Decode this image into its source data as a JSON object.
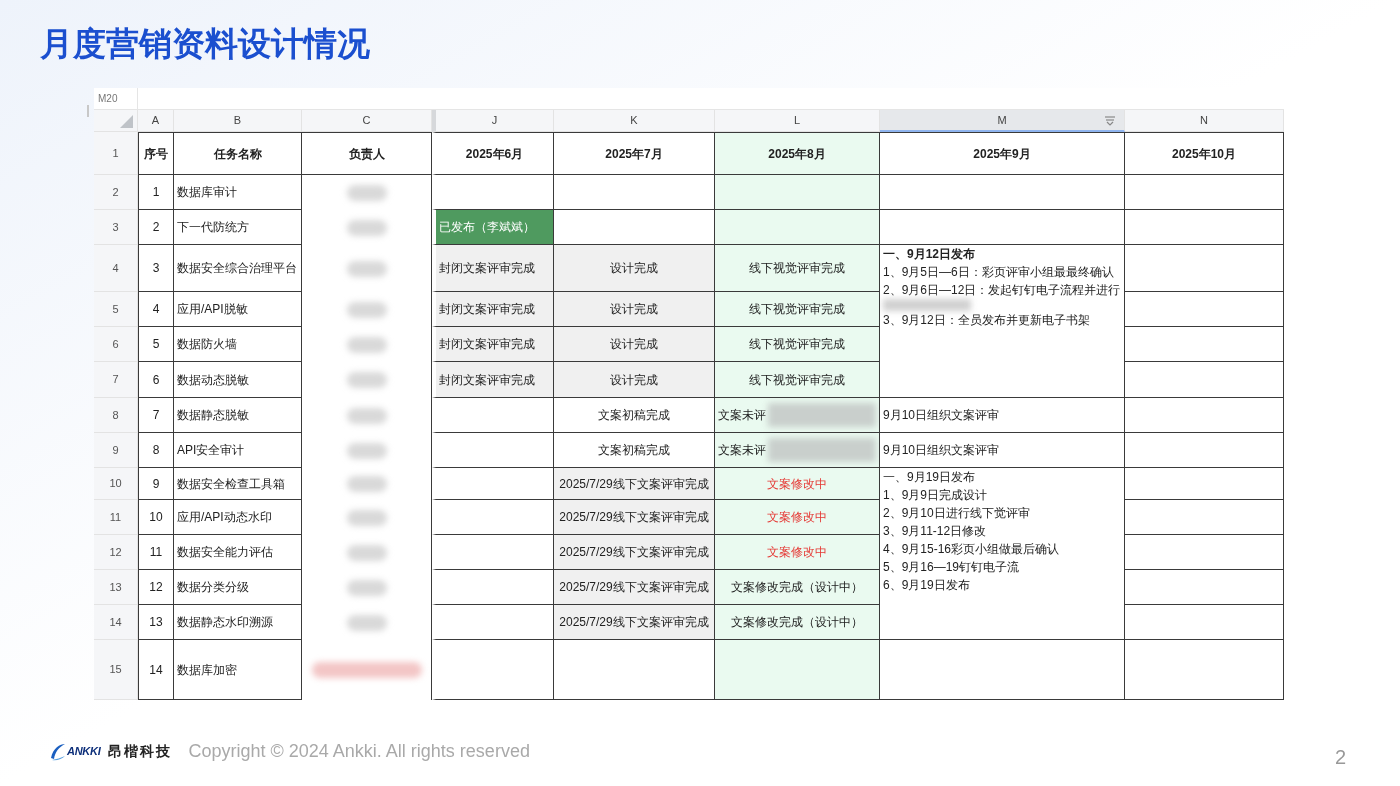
{
  "title": "月度营销资料设计情况",
  "sheet": {
    "name_box": "M20",
    "columns": [
      {
        "letter": "A",
        "highlight": false,
        "selected": false
      },
      {
        "letter": "B",
        "highlight": false,
        "selected": false
      },
      {
        "letter": "C",
        "highlight": false,
        "selected": false
      },
      {
        "letter": "J",
        "highlight": false,
        "selected": false
      },
      {
        "letter": "K",
        "highlight": false,
        "selected": false
      },
      {
        "letter": "L",
        "highlight": true,
        "selected": false
      },
      {
        "letter": "M",
        "highlight": false,
        "selected": true
      },
      {
        "letter": "N",
        "highlight": false,
        "selected": false
      }
    ],
    "rows": [
      {
        "number": "1",
        "cells": {
          "A": {
            "kind": "heading",
            "text": "序号"
          },
          "B": {
            "kind": "heading",
            "text": "任务名称"
          },
          "C": {
            "kind": "heading",
            "text": "负责人"
          },
          "J": {
            "kind": "heading",
            "text": "2025年6月"
          },
          "K": {
            "kind": "heading",
            "text": "2025年7月"
          },
          "L": {
            "kind": "heading",
            "text": "2025年8月"
          },
          "M": {
            "kind": "heading",
            "text": "2025年9月"
          },
          "N": {
            "kind": "heading",
            "text": "2025年10月"
          }
        }
      },
      {
        "number": "2",
        "cells": {
          "A": {
            "kind": "text",
            "text": "1"
          },
          "B": {
            "kind": "text",
            "text": "数据库审计"
          },
          "C": {
            "kind": "redacted"
          },
          "J": {
            "kind": "plain"
          },
          "K": {
            "kind": "plain"
          },
          "L": {
            "kind": "plain"
          },
          "M": {
            "kind": "plain"
          },
          "N": {
            "kind": "plain"
          }
        }
      },
      {
        "number": "3",
        "cells": {
          "A": {
            "kind": "text",
            "text": "2"
          },
          "B": {
            "kind": "text",
            "text": "下一代防统方"
          },
          "C": {
            "kind": "redacted"
          },
          "J": {
            "kind": "published",
            "text": "已发布（李斌斌）"
          },
          "K": {
            "kind": "plain"
          },
          "L": {
            "kind": "plain"
          },
          "M": {
            "kind": "plain"
          },
          "N": {
            "kind": "plain"
          }
        }
      },
      {
        "number": "4",
        "cells": {
          "A": {
            "kind": "text",
            "text": "3"
          },
          "B": {
            "kind": "text",
            "text": "数据安全综合治理平台"
          },
          "C": {
            "kind": "redacted"
          },
          "J": {
            "kind": "gray",
            "text": "封闭文案评审完成"
          },
          "K": {
            "kind": "gray",
            "text": "设计完成"
          },
          "L": {
            "kind": "text",
            "text": "线下视觉评审完成"
          },
          "M": {
            "kind": "notes",
            "lines": [
              {
                "kind": "text",
                "bold": true,
                "text": "一、9月12日发布"
              },
              {
                "kind": "text",
                "bold": false,
                "text": "1、9月5日—6日：彩页评审小组最最终确认"
              },
              {
                "kind": "text",
                "bold": false,
                "text": "2、9月6日—12日：发起钉钉电子流程并进行"
              },
              {
                "kind": "redacted"
              },
              {
                "kind": "text",
                "bold": false,
                "text": "3、9月12日：全员发布并更新电子书架"
              }
            ]
          },
          "N": {
            "kind": "plain"
          }
        }
      },
      {
        "number": "5",
        "cells": {
          "A": {
            "kind": "text",
            "text": "4"
          },
          "B": {
            "kind": "text",
            "text": "应用/API脱敏"
          },
          "C": {
            "kind": "redacted"
          },
          "J": {
            "kind": "gray",
            "text": "封闭文案评审完成"
          },
          "K": {
            "kind": "gray",
            "text": "设计完成"
          },
          "L": {
            "kind": "text",
            "text": "线下视觉评审完成"
          },
          "N": {
            "kind": "plain"
          }
        }
      },
      {
        "number": "6",
        "cells": {
          "A": {
            "kind": "text",
            "text": "5"
          },
          "B": {
            "kind": "text",
            "text": "数据防火墙"
          },
          "C": {
            "kind": "redacted"
          },
          "J": {
            "kind": "gray",
            "text": "封闭文案评审完成"
          },
          "K": {
            "kind": "gray",
            "text": "设计完成"
          },
          "L": {
            "kind": "text",
            "text": "线下视觉评审完成"
          },
          "N": {
            "kind": "plain"
          }
        }
      },
      {
        "number": "7",
        "cells": {
          "A": {
            "kind": "text",
            "text": "6"
          },
          "B": {
            "kind": "text",
            "text": "数据动态脱敏"
          },
          "C": {
            "kind": "redacted"
          },
          "J": {
            "kind": "gray",
            "text": "封闭文案评审完成"
          },
          "K": {
            "kind": "gray",
            "text": "设计完成"
          },
          "L": {
            "kind": "text",
            "text": "线下视觉评审完成"
          },
          "N": {
            "kind": "plain"
          }
        }
      },
      {
        "number": "8",
        "cells": {
          "A": {
            "kind": "text",
            "text": "7"
          },
          "B": {
            "kind": "text",
            "text": "数据静态脱敏"
          },
          "C": {
            "kind": "redacted"
          },
          "J": {
            "kind": "plain"
          },
          "K": {
            "kind": "text",
            "text": "文案初稿完成"
          },
          "L": {
            "kind": "partial",
            "text": "文案未评"
          },
          "M": {
            "kind": "text",
            "text": "9月10日组织文案评审"
          },
          "N": {
            "kind": "plain"
          }
        }
      },
      {
        "number": "9",
        "cells": {
          "A": {
            "kind": "text",
            "text": "8"
          },
          "B": {
            "kind": "text",
            "text": "API安全审计"
          },
          "C": {
            "kind": "redacted"
          },
          "J": {
            "kind": "plain"
          },
          "K": {
            "kind": "text",
            "text": "文案初稿完成"
          },
          "L": {
            "kind": "partial",
            "text": "文案未评"
          },
          "M": {
            "kind": "text",
            "text": "9月10日组织文案评审"
          },
          "N": {
            "kind": "plain"
          }
        }
      },
      {
        "number": "10",
        "cells": {
          "A": {
            "kind": "text",
            "text": "9"
          },
          "B": {
            "kind": "text",
            "text": "数据安全检查工具箱"
          },
          "C": {
            "kind": "redacted"
          },
          "J": {
            "kind": "plain"
          },
          "K": {
            "kind": "gray",
            "text": "2025/7/29线下文案评审完成"
          },
          "L": {
            "kind": "alert",
            "text": "文案修改中"
          },
          "M": {
            "kind": "notes",
            "lines": [
              {
                "kind": "text",
                "bold": false,
                "text": "一、9月19日发布"
              },
              {
                "kind": "text",
                "bold": false,
                "text": "1、9月9日完成设计"
              },
              {
                "kind": "text",
                "bold": false,
                "text": "2、9月10日进行线下觉评审"
              },
              {
                "kind": "text",
                "bold": false,
                "text": "3、9月11-12日修改"
              },
              {
                "kind": "text",
                "bold": false,
                "text": "4、9月15-16彩页小组做最后确认"
              },
              {
                "kind": "text",
                "bold": false,
                "text": "5、9月16—19钉钉电子流"
              },
              {
                "kind": "text",
                "bold": false,
                "text": "6、9月19日发布"
              }
            ]
          },
          "N": {
            "kind": "plain"
          }
        }
      },
      {
        "number": "11",
        "cells": {
          "A": {
            "kind": "text",
            "text": "10"
          },
          "B": {
            "kind": "text",
            "text": "应用/API动态水印"
          },
          "C": {
            "kind": "redacted"
          },
          "J": {
            "kind": "plain"
          },
          "K": {
            "kind": "gray",
            "text": "2025/7/29线下文案评审完成"
          },
          "L": {
            "kind": "alert",
            "text": "文案修改中"
          },
          "N": {
            "kind": "plain"
          }
        }
      },
      {
        "number": "12",
        "cells": {
          "A": {
            "kind": "text",
            "text": "11"
          },
          "B": {
            "kind": "text",
            "text": "数据安全能力评估"
          },
          "C": {
            "kind": "redacted"
          },
          "J": {
            "kind": "plain"
          },
          "K": {
            "kind": "gray",
            "text": "2025/7/29线下文案评审完成"
          },
          "L": {
            "kind": "alert",
            "text": "文案修改中"
          },
          "N": {
            "kind": "plain"
          }
        }
      },
      {
        "number": "13",
        "cells": {
          "A": {
            "kind": "text",
            "text": "12"
          },
          "B": {
            "kind": "text",
            "text": "数据分类分级"
          },
          "C": {
            "kind": "redacted"
          },
          "J": {
            "kind": "plain"
          },
          "K": {
            "kind": "gray",
            "text": "2025/7/29线下文案评审完成"
          },
          "L": {
            "kind": "text",
            "text": "文案修改完成（设计中）"
          },
          "N": {
            "kind": "plain"
          }
        }
      },
      {
        "number": "14",
        "cells": {
          "A": {
            "kind": "text",
            "text": "13"
          },
          "B": {
            "kind": "text",
            "text": "数据静态水印溯源"
          },
          "C": {
            "kind": "redacted"
          },
          "J": {
            "kind": "plain"
          },
          "K": {
            "kind": "gray",
            "text": "2025/7/29线下文案评审完成"
          },
          "L": {
            "kind": "text",
            "text": "文案修改完成（设计中）"
          },
          "N": {
            "kind": "plain"
          }
        }
      },
      {
        "number": "15",
        "cells": {
          "A": {
            "kind": "text",
            "text": "14"
          },
          "B": {
            "kind": "text",
            "text": "数据库加密"
          },
          "C": {
            "kind": "redacted_alert"
          },
          "J": {
            "kind": "plain"
          },
          "K": {
            "kind": "plain"
          },
          "L": {
            "kind": "plain"
          },
          "M": {
            "kind": "plain"
          },
          "N": {
            "kind": "plain"
          }
        }
      }
    ]
  },
  "footer": {
    "logo": "ANKKI",
    "company": "昂楷科技",
    "copyright": "Copyright © 2024 Ankki. All rights reserved",
    "page": "2"
  }
}
